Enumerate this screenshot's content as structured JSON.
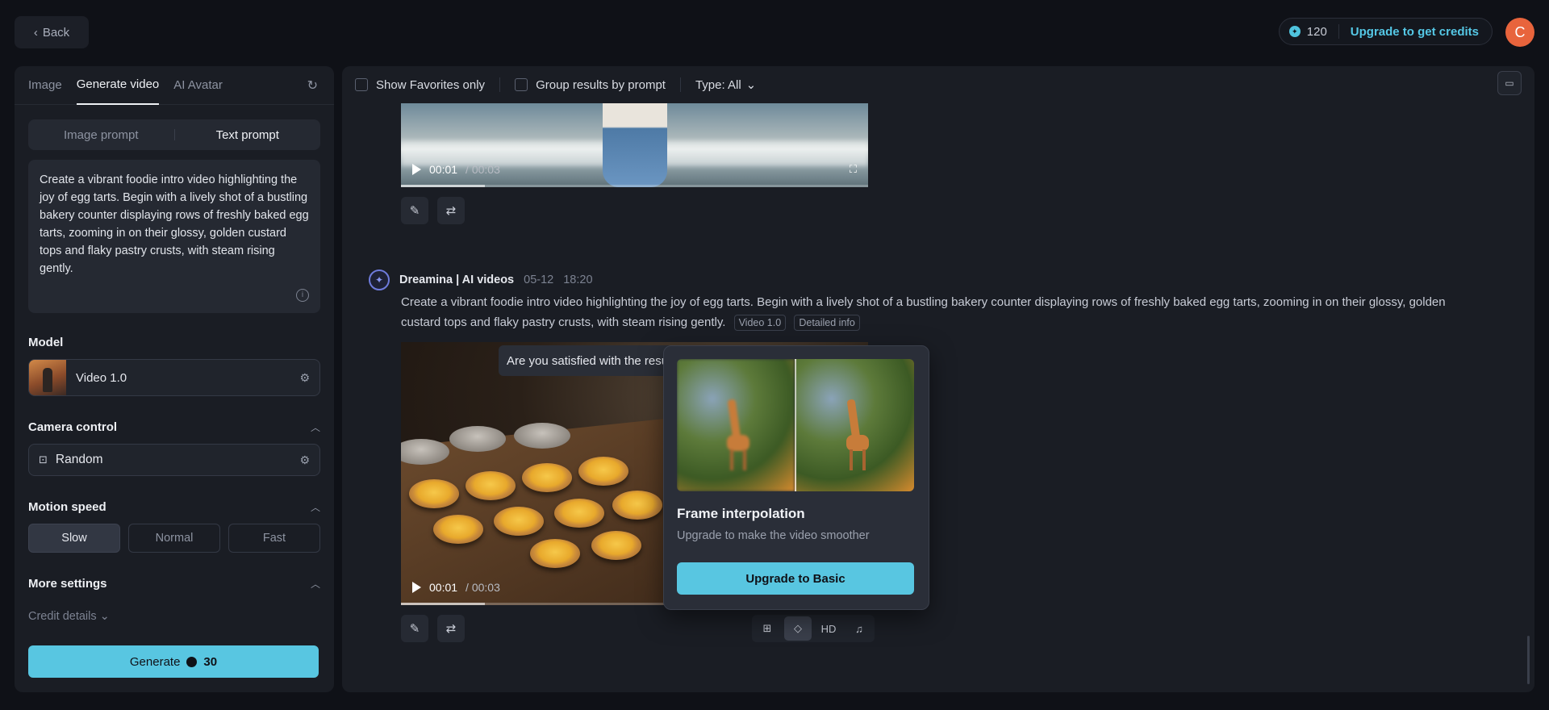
{
  "topbar": {
    "back_label": "Back",
    "credits_count": "120",
    "upgrade_label": "Upgrade to get credits",
    "avatar_initial": "C"
  },
  "left_panel": {
    "tabs": [
      {
        "label": "Image",
        "active": false
      },
      {
        "label": "Generate video",
        "active": true
      },
      {
        "label": "AI Avatar",
        "active": false
      }
    ],
    "prompt_modes": {
      "image": "Image prompt",
      "text": "Text prompt",
      "active": "text"
    },
    "prompt_text": "Create a vibrant foodie intro video highlighting the joy of egg tarts. Begin with a lively shot of a bustling bakery counter displaying rows of freshly baked egg tarts, zooming in on their glossy, golden custard tops and flaky pastry crusts, with steam rising gently.",
    "model_title": "Model",
    "model_value": "Video 1.0",
    "camera_title": "Camera control",
    "camera_value": "Random",
    "motion_title": "Motion speed",
    "motion_options": [
      "Slow",
      "Normal",
      "Fast"
    ],
    "motion_selected": "Slow",
    "more_settings_title": "More settings",
    "credit_details_label": "Credit details",
    "generate_label": "Generate",
    "generate_cost": "30"
  },
  "main": {
    "filters": {
      "favorites_label": "Show Favorites only",
      "group_label": "Group results by prompt",
      "type_label": "Type: All"
    },
    "video1": {
      "current": "00:01",
      "total": "/ 00:03",
      "progress_fraction": 0.18
    },
    "generation": {
      "author": "Dreamina | AI videos",
      "date": "05-12",
      "time": "18:20",
      "prompt": "Create a vibrant foodie intro video highlighting the joy of egg tarts. Begin with a lively shot of a bustling bakery counter displaying rows of freshly baked egg tarts, zooming in on their glossy, golden custard tops and flaky pastry crusts, with steam rising gently.",
      "tag_model": "Video 1.0",
      "tag_info": "Detailed info"
    },
    "video2": {
      "current": "00:01",
      "total": "/ 00:03",
      "progress_fraction": 0.18,
      "satisfied_prompt": "Are you satisfied with the resu"
    },
    "popup": {
      "title": "Frame interpolation",
      "subtitle": "Upgrade to make the video smoother",
      "button_label": "Upgrade to Basic"
    },
    "tools": {
      "hd_label": "HD"
    }
  },
  "colors": {
    "accent": "#58c6e1",
    "avatar": "#e8643c",
    "panel": "#1a1d24",
    "background": "#0f1117"
  }
}
